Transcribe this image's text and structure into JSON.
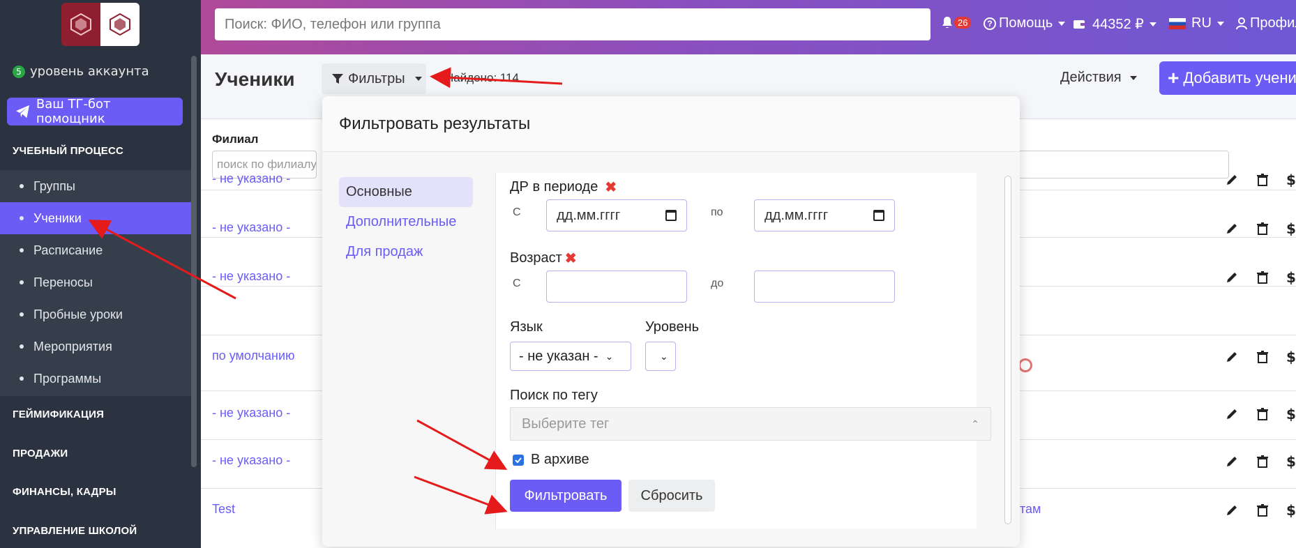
{
  "sidebar": {
    "account_level_badge": "5",
    "account_level_label": "уровень аккаунта",
    "tg_button": "Ваш ТГ-бот помощник",
    "sections": {
      "learning": "УЧЕБНЫЙ ПРОЦЕСС",
      "gamification": "ГЕЙМИФИКАЦИЯ",
      "sales": "ПРОДАЖИ",
      "finance": "ФИНАНСЫ, КАДРЫ",
      "school": "УПРАВЛЕНИЕ ШКОЛОЙ"
    },
    "items": [
      {
        "label": "Группы"
      },
      {
        "label": "Ученики",
        "active": true
      },
      {
        "label": "Расписание"
      },
      {
        "label": "Переносы"
      },
      {
        "label": "Пробные уроки"
      },
      {
        "label": "Мероприятия"
      },
      {
        "label": "Программы"
      }
    ]
  },
  "topbar": {
    "search_placeholder": "Поиск: ФИО, телефон или группа",
    "notifications_count": "26",
    "help": "Помощь",
    "balance": "44352 ₽",
    "language": "RU",
    "profile": "Профиль"
  },
  "page": {
    "title": "Ученики",
    "filters_button": "Фильтры",
    "found": "Найдено: 114",
    "actions": "Действия",
    "add_button": "Добавить ученика",
    "column_branch": "Филиал",
    "branch_search_placeholder": "поиск по филиалу",
    "rows": [
      {
        "branch": "- не указано -"
      },
      {
        "branch": "- не указано -"
      },
      {
        "branch": "- не указано -"
      },
      {
        "branch": "по умолчанию"
      },
      {
        "branch": "- не указано -"
      },
      {
        "branch": "- не указано -"
      },
      {
        "branch": "Test",
        "extra": "там"
      }
    ]
  },
  "filter_modal": {
    "title": "Фильтровать результаты",
    "tabs": [
      "Основные",
      "Дополнительные",
      "Для продаж"
    ],
    "birthday_label": "ДР в периоде",
    "from_label": "С",
    "to_label_period": "по",
    "date_placeholder": "дд.мм.гггг",
    "age_label": "Возраст",
    "to_label_age": "до",
    "language_label": "Язык",
    "language_value": "- не указан -",
    "level_label": "Уровень",
    "level_value": "",
    "tag_label": "Поиск по тегу",
    "tag_placeholder": "Выберите тег",
    "archive_label": "В архиве",
    "archive_checked": true,
    "filter_button": "Фильтровать",
    "reset_button": "Сбросить"
  },
  "colors": {
    "accent": "#6b5cf6",
    "sidebar": "#2b3340",
    "arrow": "#e51b1b"
  }
}
